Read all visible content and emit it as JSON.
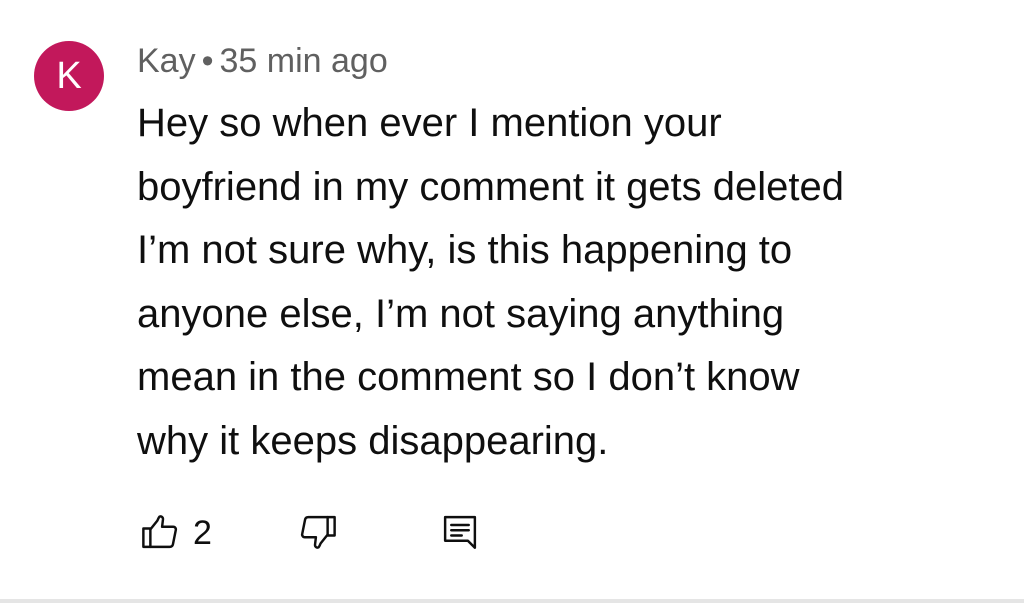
{
  "comment": {
    "avatar_letter": "K",
    "avatar_color": "#c2185b",
    "author": "Kay",
    "separator": "•",
    "timestamp": "35 min ago",
    "lines": [
      "Hey so when ever I mention your",
      "boyfriend in my comment it gets deleted",
      "I’m not sure why, is this happening to",
      "anyone else, I’m not saying anything",
      "mean in the comment so I don’t know",
      "why it keeps disappearing."
    ],
    "like_count": "2"
  },
  "icons": {
    "like": "thumbs-up-icon",
    "dislike": "thumbs-down-icon",
    "reply": "comment-reply-icon"
  }
}
